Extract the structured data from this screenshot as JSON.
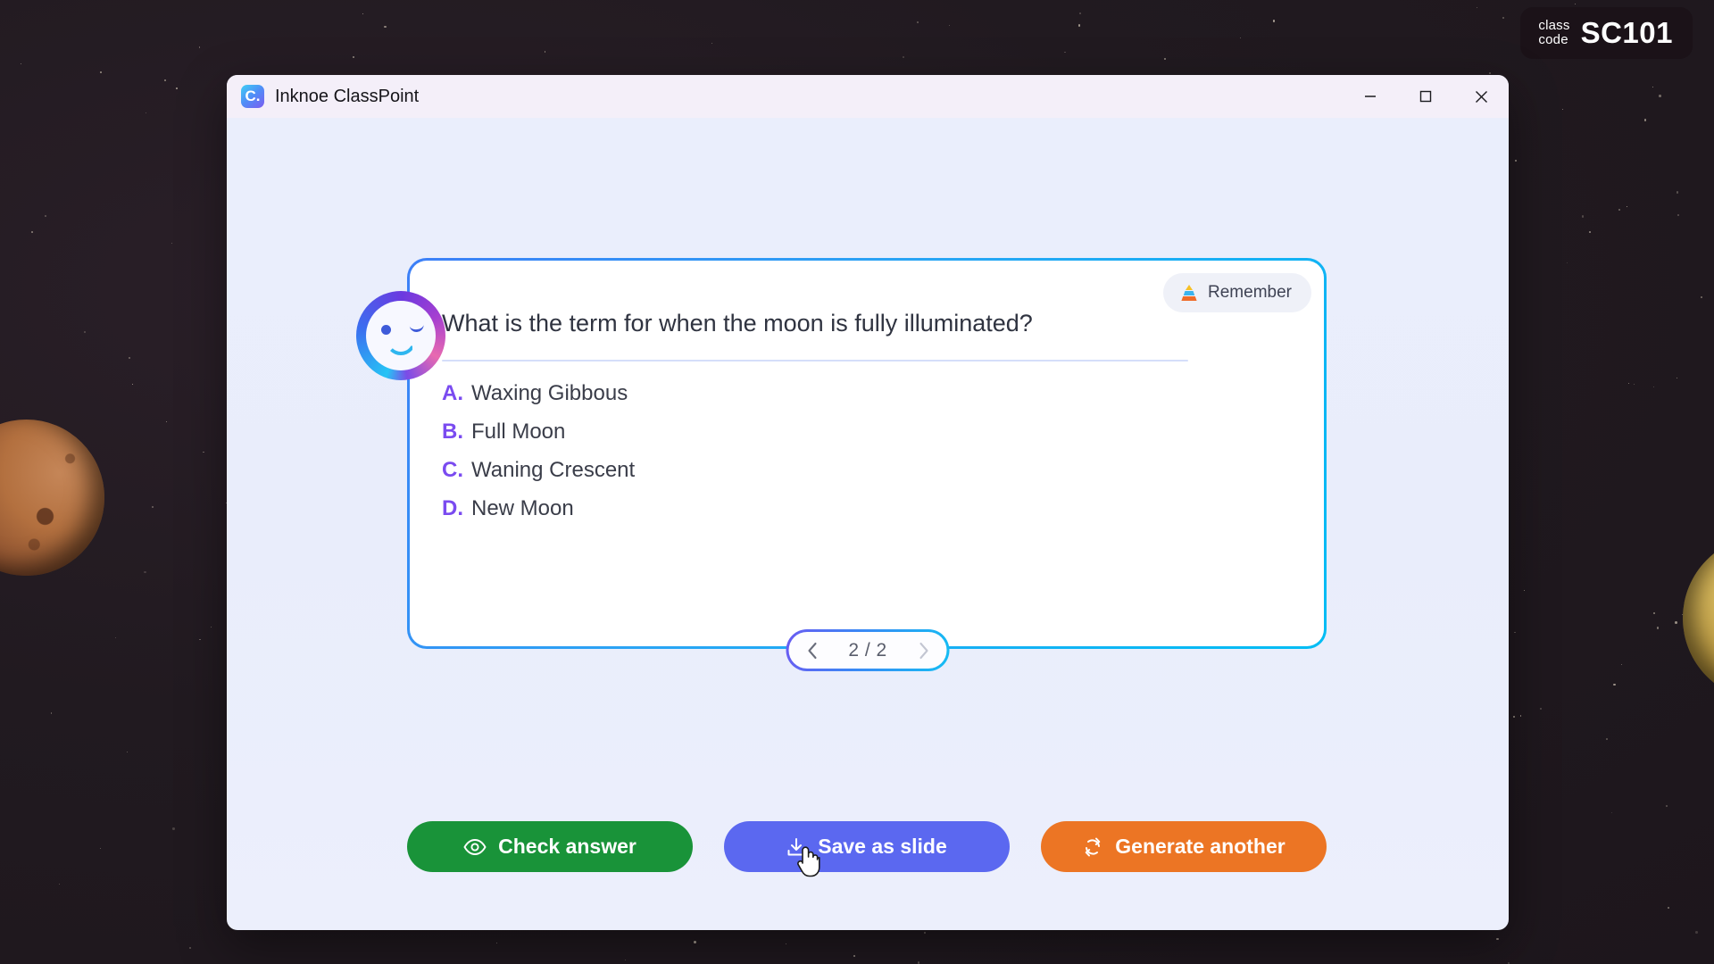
{
  "class_code": {
    "label": "class\ncode",
    "value": "SC101"
  },
  "window": {
    "title": "Inknoe ClassPoint",
    "app_icon": "classpoint-logo-icon",
    "controls": {
      "minimize": "minimize-icon",
      "maximize": "maximize-icon",
      "close": "close-icon"
    }
  },
  "card": {
    "avatar": "ai-assistant-avatar",
    "taxonomy_badge": {
      "icon": "blooms-pyramid-icon",
      "label": "Remember"
    },
    "question": "What is the term for when the moon is fully illuminated?",
    "options": [
      {
        "letter": "A.",
        "text": "Waxing Gibbous"
      },
      {
        "letter": "B.",
        "text": "Full Moon"
      },
      {
        "letter": "C.",
        "text": "Waning Crescent"
      },
      {
        "letter": "D.",
        "text": "New Moon"
      }
    ]
  },
  "pagination": {
    "prev_icon": "chevron-left-icon",
    "indicator": "2 / 2",
    "next_icon": "chevron-right-icon",
    "current_page": 2,
    "total_pages": 2
  },
  "actions": {
    "check_answer": {
      "label": "Check answer",
      "icon": "eye-icon",
      "color": "#199339"
    },
    "save_as_slide": {
      "label": "Save as slide",
      "icon": "download-icon",
      "color": "#5b68f0"
    },
    "generate_another": {
      "label": "Generate another",
      "icon": "refresh-icon",
      "color": "#ec7524"
    }
  },
  "colors": {
    "card_border_start": "#3d7ff7",
    "card_border_end": "#00bdf4",
    "option_letter": "#7a4bf0",
    "divider": "#d5defa"
  }
}
